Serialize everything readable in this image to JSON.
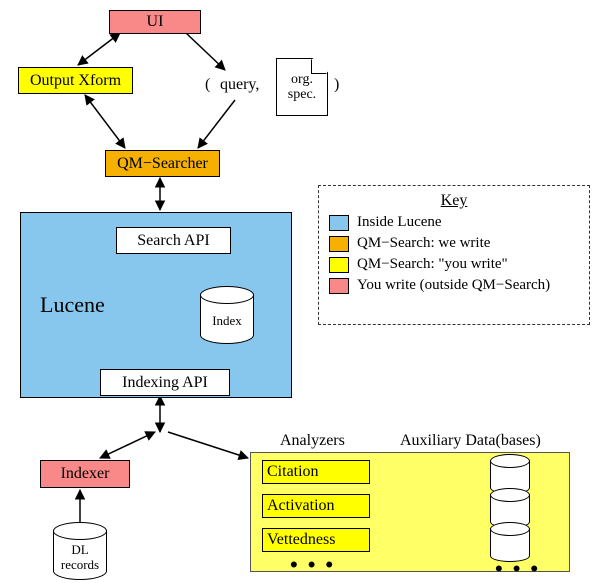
{
  "nodes": {
    "ui": {
      "label": "UI"
    },
    "outputXform": {
      "label": "Output Xform"
    },
    "qmSearcher": {
      "label": "QM−Searcher"
    },
    "searchApi": {
      "label": "Search API"
    },
    "indexingApi": {
      "label": "Indexing API"
    },
    "indexer": {
      "label": "Indexer"
    },
    "lucene": {
      "label": "Lucene"
    },
    "indexDb": {
      "label": "Index"
    },
    "dlRecords": {
      "label": "DL\nrecords"
    },
    "orgDoc": {
      "label": "org.\nspec."
    },
    "queryPair": {
      "open": "( ",
      "q": "query,",
      "close": ")"
    }
  },
  "analyzersPanel": {
    "heading": "Analyzers",
    "items": [
      "Citation",
      "Activation",
      "Vettedness"
    ]
  },
  "auxPanel": {
    "heading": "Auxiliary Data(bases)"
  },
  "legend": {
    "title": "Key",
    "rows": [
      {
        "color": "#87c7ee",
        "label": "Inside Lucene"
      },
      {
        "color": "#f6b100",
        "label": "QM−Search: we write"
      },
      {
        "color": "#ffff00",
        "label": "QM−Search: \"you write\""
      },
      {
        "color": "#f98888",
        "label": "You write (outside QM−Search)"
      }
    ]
  },
  "styleColors": {
    "pink": "#f98888",
    "yellow": "#ffff00",
    "orange": "#f6b100",
    "white": "#ffffff",
    "blue": "#87c7ee",
    "paleyellow": "#ffff66"
  }
}
